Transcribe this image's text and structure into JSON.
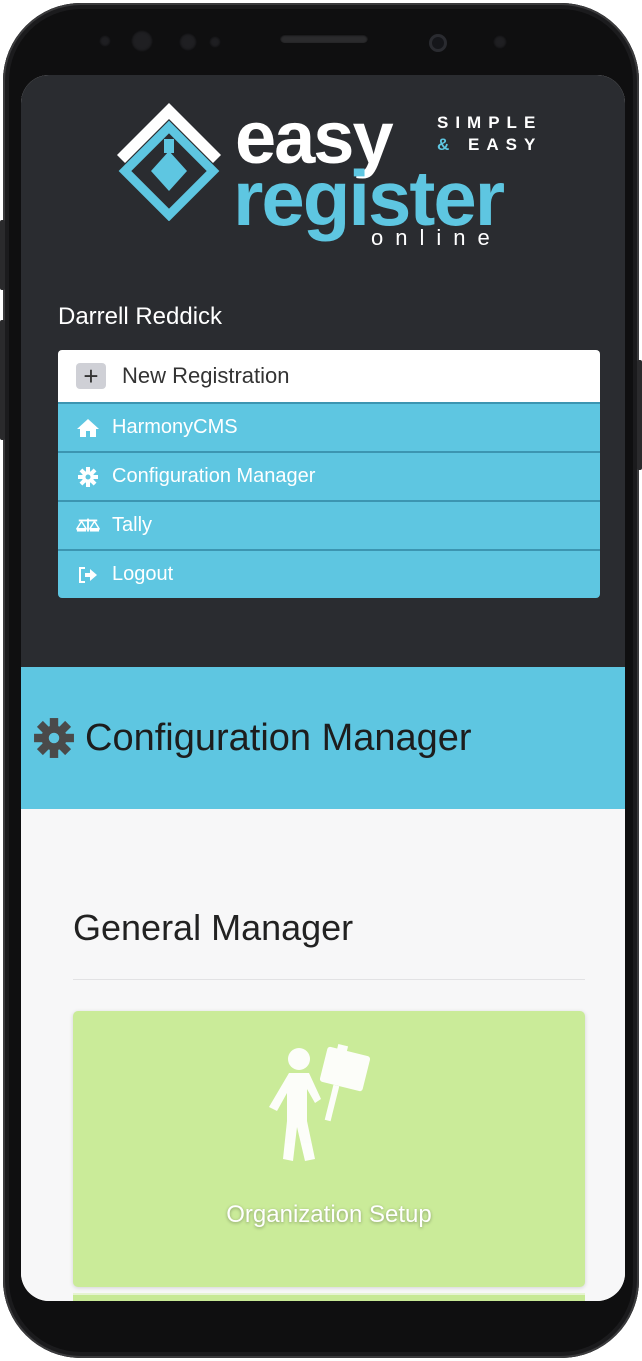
{
  "logo": {
    "easy": "easy",
    "simple": "SIMPLE",
    "and_easy_amp": "&",
    "and_easy": "EASY",
    "register": "register",
    "online": "online"
  },
  "user": {
    "name": "Darrell Reddick"
  },
  "menu": {
    "new_registration": "New Registration",
    "items": [
      {
        "label": "HarmonyCMS",
        "icon": "home-icon"
      },
      {
        "label": "Configuration Manager",
        "icon": "gear-icon"
      },
      {
        "label": "Tally",
        "icon": "scale-icon"
      },
      {
        "label": "Logout",
        "icon": "logout-icon"
      }
    ]
  },
  "header": {
    "title": "Configuration Manager",
    "icon": "gear-icon"
  },
  "section": {
    "title": "General Manager",
    "cards": [
      {
        "label": "Organization Setup",
        "icon": "person-sign-icon"
      }
    ]
  },
  "colors": {
    "dark_bg": "#2a2c30",
    "accent": "#5ec6e1",
    "card_green": "#caeb99"
  }
}
